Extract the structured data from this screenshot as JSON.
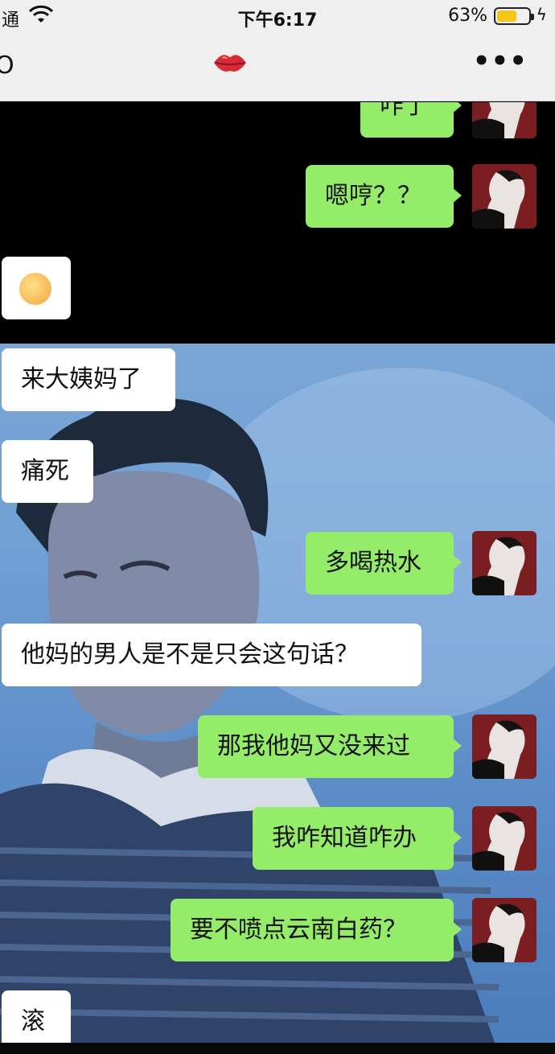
{
  "status_bar": {
    "carrier": "通",
    "time": "下午6:17",
    "battery_percent": "63%",
    "battery_level": 0.63
  },
  "nav": {
    "title_icon": "lips-icon",
    "more_icon": "more-icon",
    "more_label": "•••"
  },
  "messages": [
    {
      "side": "out",
      "text": "咋了"
    },
    {
      "side": "out",
      "text": "嗯哼？？"
    },
    {
      "side": "in",
      "text": "",
      "kind": "emoji",
      "icon": "laughing-emoji-icon"
    },
    {
      "side": "in",
      "text": "来大姨妈了"
    },
    {
      "side": "in",
      "text": "痛死"
    },
    {
      "side": "out",
      "text": "多喝热水"
    },
    {
      "side": "in",
      "text": "他妈的男人是不是只会这句话？"
    },
    {
      "side": "out",
      "text": "那我他妈又没来过"
    },
    {
      "side": "out",
      "text": "我咋知道咋办"
    },
    {
      "side": "out",
      "text": "要不喷点云南白药？"
    },
    {
      "side": "in",
      "text": "滚"
    }
  ],
  "colors": {
    "bar_bg": "#efefef",
    "bubble_out": "#95ec69",
    "bubble_in": "#ffffff",
    "chat_bg_top": "#000000",
    "battery_fill": "#f5c518"
  }
}
